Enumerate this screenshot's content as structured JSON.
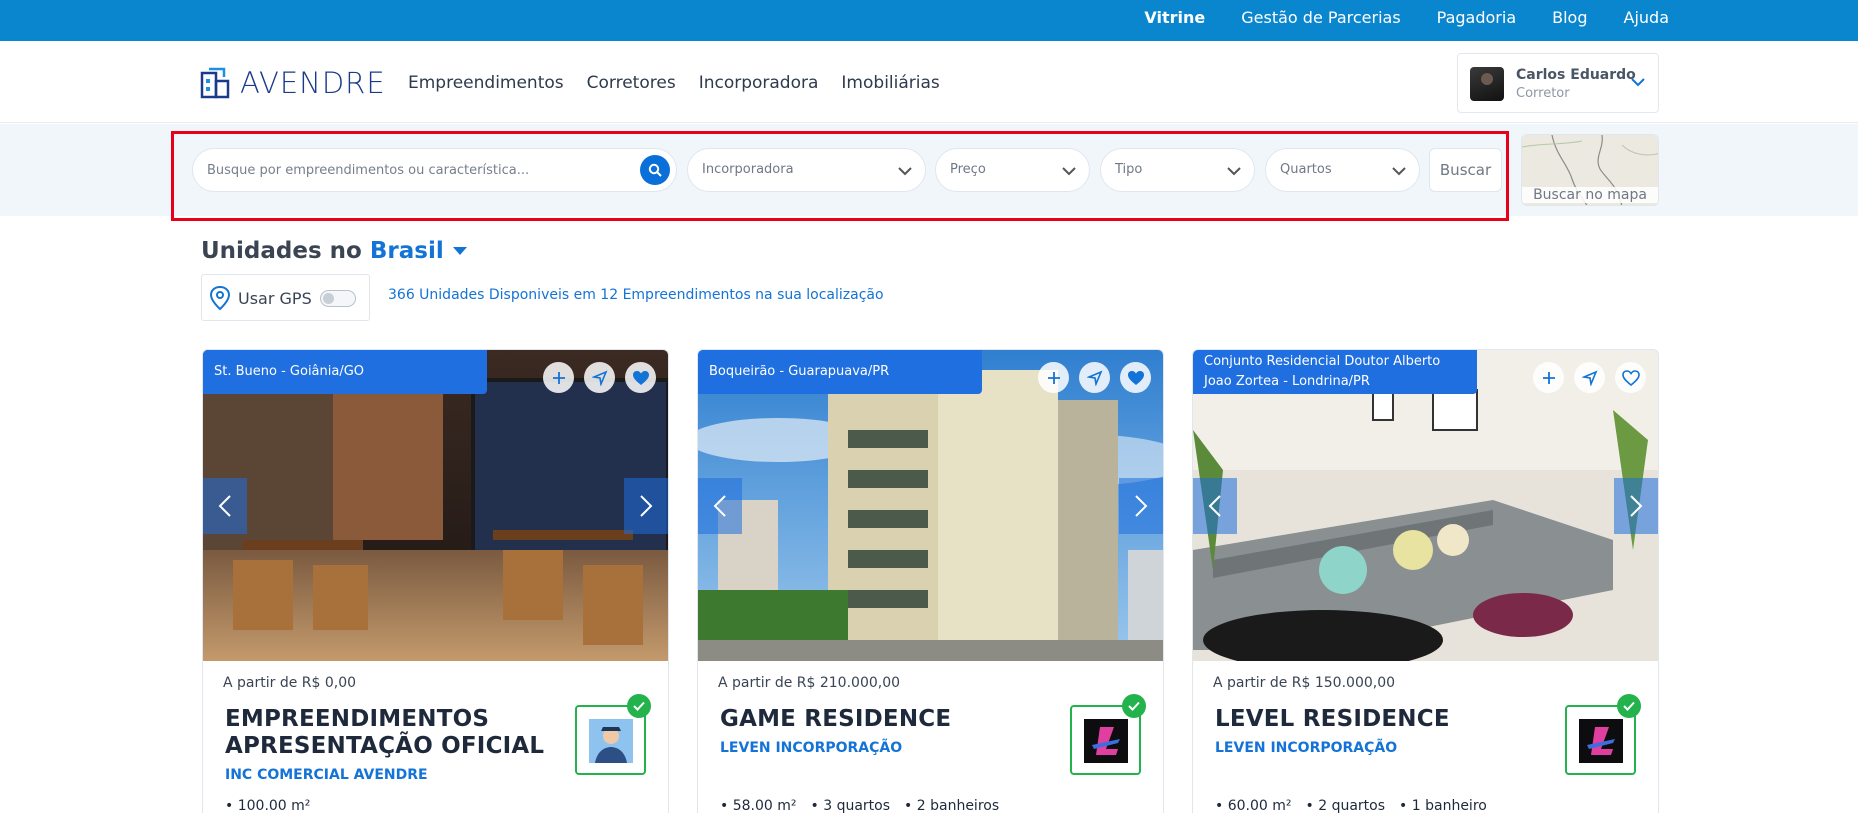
{
  "topnav": {
    "items": [
      "Vitrine",
      "Gestão de Parcerias",
      "Pagadoria",
      "Blog",
      "Ajuda"
    ]
  },
  "header": {
    "logo_text": "AVENDRE",
    "nav": [
      "Empreendimentos",
      "Corretores",
      "Incorporadora",
      "Imobiliárias"
    ],
    "user": {
      "name": "Carlos Eduardo",
      "role": "Corretor"
    }
  },
  "search": {
    "placeholder": "Busque por empreendimentos ou característica...",
    "filters": [
      "Incorporadora",
      "Preço",
      "Tipo",
      "Quartos"
    ],
    "submit_label": "Buscar",
    "map_label": "Buscar no mapa"
  },
  "units": {
    "title_prefix": "Unidades no",
    "location": "Brasil",
    "gps_label": "Usar GPS",
    "available_text": "366 Unidades Disponiveis em 12 Empreendimentos na sua localização"
  },
  "cards": [
    {
      "location": "St. Bueno - Goiânia/GO",
      "price": "A partir de R$ 0,00",
      "title": "EMPREENDIMENTOS APRESENTAÇÃO OFICIAL",
      "builder": "INC COMERCIAL AVENDRE",
      "specs": [
        "100.00 m²"
      ]
    },
    {
      "location": "Boqueirão - Guarapuava/PR",
      "price": "A partir de R$ 210.000,00",
      "title": "GAME RESIDENCE",
      "builder": "LEVEN INCORPORAÇÃO",
      "specs": [
        "58.00 m²",
        "3 quartos",
        "2 banheiros"
      ]
    },
    {
      "location": "Conjunto Residencial Doutor Alberto Joao Zortea - Londrina/PR",
      "price": "A partir de R$ 150.000,00",
      "title": "LEVEL RESIDENCE",
      "builder": "LEVEN INCORPORAÇÃO",
      "specs": [
        "60.00 m²",
        "2 quartos",
        "1 banheiro"
      ]
    }
  ],
  "colors": {
    "topbar": "#0a86cf",
    "accent": "#1373d6",
    "tag": "#1f6fe0",
    "verified": "#23b24b",
    "highlight": "#e8001a"
  }
}
